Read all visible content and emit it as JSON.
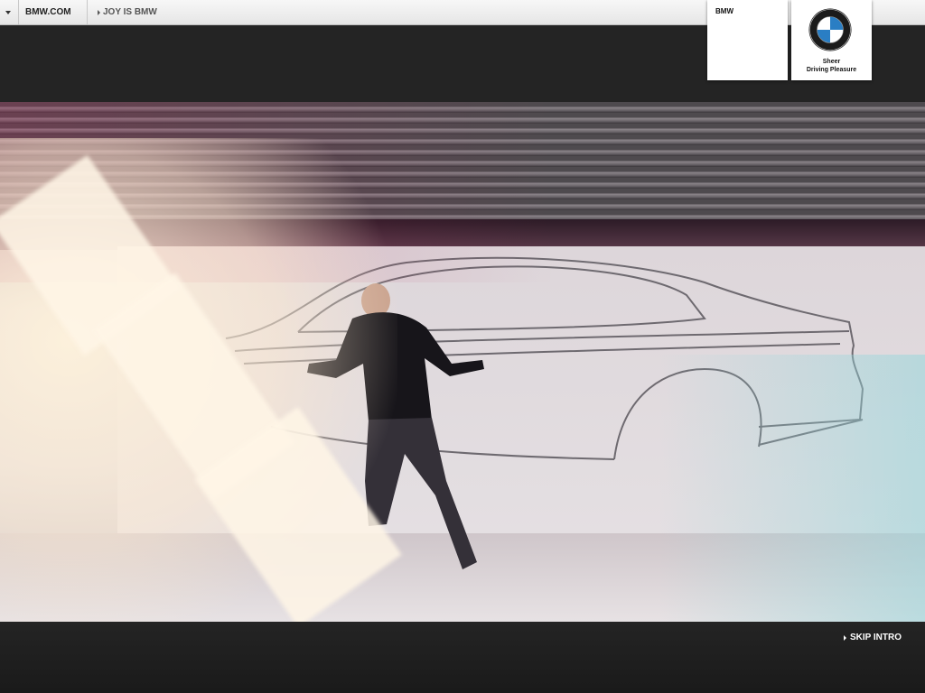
{
  "topnav": {
    "menu_icon": "triangle-down-icon",
    "home_label": "BMW.COM",
    "breadcrumb_arrow": "triangle-right-icon",
    "breadcrumb_label": "JOY IS BMW"
  },
  "brand": {
    "tile_label": "BMW",
    "logo_icon": "bmw-roundel-logo",
    "tagline_line1": "Sheer",
    "tagline_line2": "Driving Pleasure"
  },
  "video": {
    "scene": "designer-sketching-car-on-wall"
  },
  "footer": {
    "skip_label": "SKIP INTRO",
    "skip_icon": "triangle-right-icon"
  },
  "colors": {
    "bar_dark": "#242424",
    "bmw_blue": "#2a7ec4",
    "tile_white": "#ffffff"
  }
}
